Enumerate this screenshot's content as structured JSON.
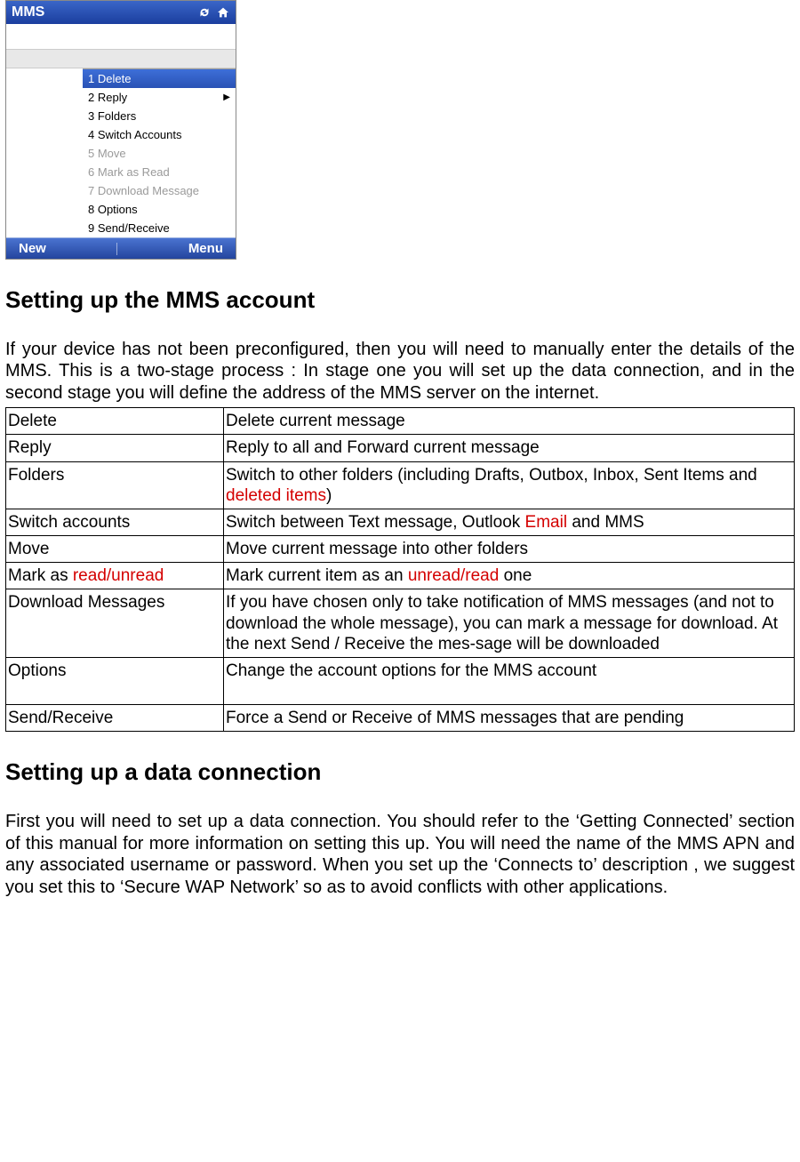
{
  "phone": {
    "status_title": "MMS",
    "menu": [
      {
        "label": "1 Delete",
        "state": "selected",
        "arrow": false
      },
      {
        "label": "2 Reply",
        "state": "normal",
        "arrow": true
      },
      {
        "label": "3 Folders",
        "state": "normal",
        "arrow": false
      },
      {
        "label": "4 Switch Accounts",
        "state": "normal",
        "arrow": false
      },
      {
        "label": "5 Move",
        "state": "disabled",
        "arrow": false
      },
      {
        "label": "6 Mark as Read",
        "state": "disabled",
        "arrow": false
      },
      {
        "label": "7 Download Message",
        "state": "disabled",
        "arrow": false
      },
      {
        "label": "8 Options",
        "state": "normal",
        "arrow": false
      },
      {
        "label": "9 Send/Receive",
        "state": "normal",
        "arrow": false
      }
    ],
    "soft_left": "New",
    "soft_right": "Menu"
  },
  "section1_title": "Setting up the MMS account",
  "section1_para": "If your device has not been preconfigured, then you will need to manually enter the details of the MMS. This is a two-stage process : In stage one you will set up the data connection, and in the second stage you will define the address of the MMS server on the internet.",
  "table_rows": [
    {
      "col1": [
        {
          "t": "Delete"
        }
      ],
      "col2": [
        {
          "t": "Delete current message"
        }
      ]
    },
    {
      "col1": [
        {
          "t": "Reply"
        }
      ],
      "col2": [
        {
          "t": "Reply to all and Forward current message"
        }
      ]
    },
    {
      "col1": [
        {
          "t": "Folders"
        }
      ],
      "col2": [
        {
          "t": "Switch to other folders (including Drafts, Outbox, Inbox, Sent Items and "
        },
        {
          "t": "deleted items",
          "c": "red"
        },
        {
          "t": ")"
        }
      ]
    },
    {
      "col1": [
        {
          "t": "Switch accounts"
        }
      ],
      "col2": [
        {
          "t": "Switch between Text message, Outlook "
        },
        {
          "t": "Email",
          "c": "red"
        },
        {
          "t": " and MMS"
        }
      ]
    },
    {
      "col1": [
        {
          "t": "Move"
        }
      ],
      "col2": [
        {
          "t": "Move current message into other folders"
        }
      ]
    },
    {
      "col1": [
        {
          "t": "Mark as "
        },
        {
          "t": "read/unread",
          "c": "red"
        }
      ],
      "col2": [
        {
          "t": "Mark current item as an "
        },
        {
          "t": "unread/read",
          "c": "red"
        },
        {
          "t": " one"
        }
      ]
    },
    {
      "col1": [
        {
          "t": "Download Messages"
        }
      ],
      "col2": [
        {
          "t": "If you have chosen only to take notification of MMS messages (and not to download the whole message), you can mark a message for download. At the next Send / Receive the mes-sage will be downloaded"
        }
      ]
    },
    {
      "col1": [
        {
          "t": "Options"
        }
      ],
      "col2": [
        {
          "t": "Change the account options for the MMS account"
        },
        {
          "t": " "
        },
        {
          "t": "",
          "br": true
        }
      ]
    },
    {
      "col1": [
        {
          "t": "Send/Receive"
        }
      ],
      "col2": [
        {
          "t": "Force a Send or Receive of MMS messages that are pending"
        }
      ]
    }
  ],
  "section2_title": "Setting up a data connection",
  "section2_para": "First you will need to set up a data connection. You should refer to the ‘Getting Connected’ section of this manual for more information on setting this up. You will need the name of the MMS APN and any associated username or password. When you set up the ‘Connects to’ description , we suggest you set this to ‘Secure WAP Network’ so as to avoid conflicts with other applications."
}
